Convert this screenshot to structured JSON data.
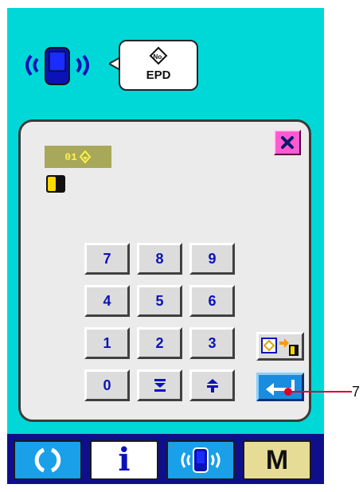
{
  "header": {
    "status_icon": "communication-phone-icon",
    "bubble_icon": "epd-input-icon",
    "bubble_label": "EPD"
  },
  "panel": {
    "close_icon": "close-x-icon",
    "tab_label": "01",
    "media_icon": "smartmedia-card-icon",
    "keypad": {
      "row1": [
        "7",
        "8",
        "9"
      ],
      "row2": [
        "4",
        "5",
        "6"
      ],
      "row3": [
        "1",
        "2",
        "3"
      ],
      "row4": [
        "0",
        "decrement-icon",
        "increment-icon"
      ]
    },
    "read_icon": "read-data-icon",
    "enter_icon": "enter-icon"
  },
  "callout": {
    "label": "7"
  },
  "bottom_bar": {
    "items": [
      {
        "name": "ready-button",
        "icon": "ready-icon"
      },
      {
        "name": "info-button",
        "icon": "info-icon",
        "label": "i"
      },
      {
        "name": "communication-button",
        "icon": "communication-icon"
      },
      {
        "name": "mode-button",
        "icon": "mode-icon",
        "label": "M"
      }
    ]
  },
  "colors": {
    "screen_bg": "#00d8d8",
    "bar_bg": "#0f0f8c",
    "accent_blue": "#0a12b8",
    "close_pink": "#ff5ad2",
    "tab_olive": "#a8a85a",
    "callout_red": "#d8002a"
  }
}
